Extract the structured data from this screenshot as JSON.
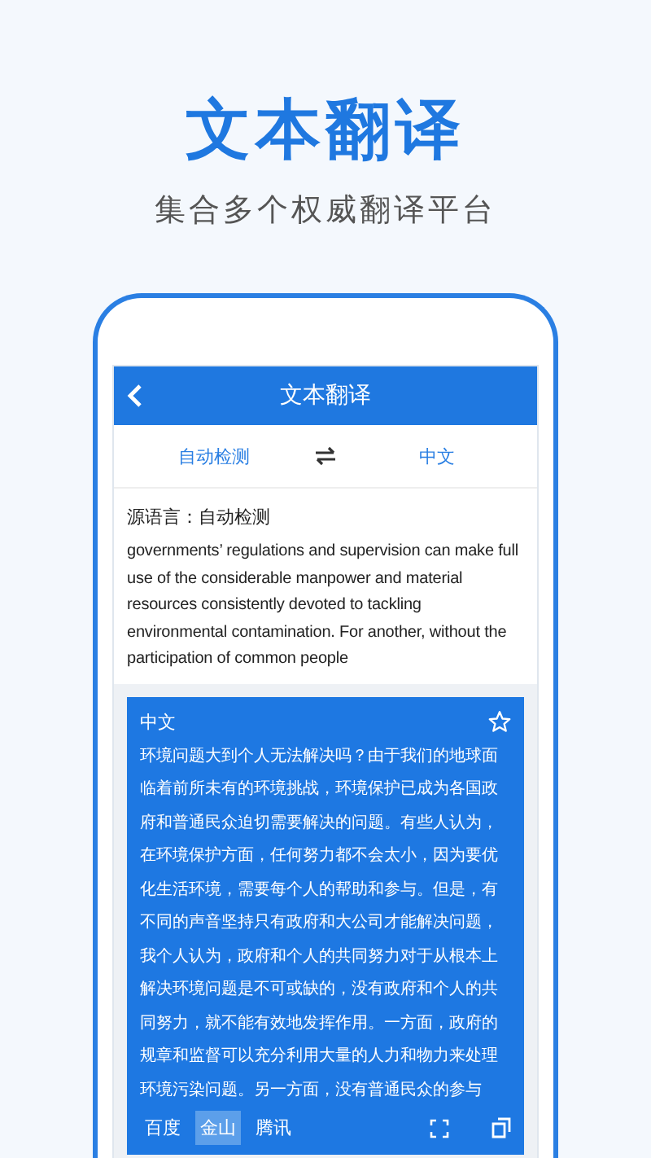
{
  "promo": {
    "title": "文本翻译",
    "subtitle": "集合多个权威翻译平台"
  },
  "nav_bar": {
    "title": "文本翻译"
  },
  "language_bar": {
    "source": "自动检测",
    "target": "中文"
  },
  "source": {
    "label": "源语言：自动检测",
    "text": "governments’ regulations and supervision can make full use of the considerable manpower and material resources consistently devoted to tackling environmental contamination. For another, without the participation of common people"
  },
  "result": {
    "language": "中文",
    "text": "环境问题大到个人无法解决吗？由于我们的地球面临着前所未有的环境挑战，环境保护已成为各国政府和普通民众迫切需要解决的问题。有些人认为，在环境保护方面，任何努力都不会太小，因为要优化生活环境，需要每个人的帮助和参与。但是，有不同的声音坚持只有政府和大公司才能解决问题，我个人认为，政府和个人的共同努力对于从根本上解决环境问题是不可或缺的，没有政府和个人的共同努力，就不能有效地发挥作用。一方面，政府的规章和监督可以充分利用大量的人力和物力来处理环境污染问题。另一方面，没有普通民众的参与",
    "engines": [
      {
        "label": "百度",
        "selected": false
      },
      {
        "label": "金山",
        "selected": true
      },
      {
        "label": "腾讯",
        "selected": false
      }
    ]
  }
}
